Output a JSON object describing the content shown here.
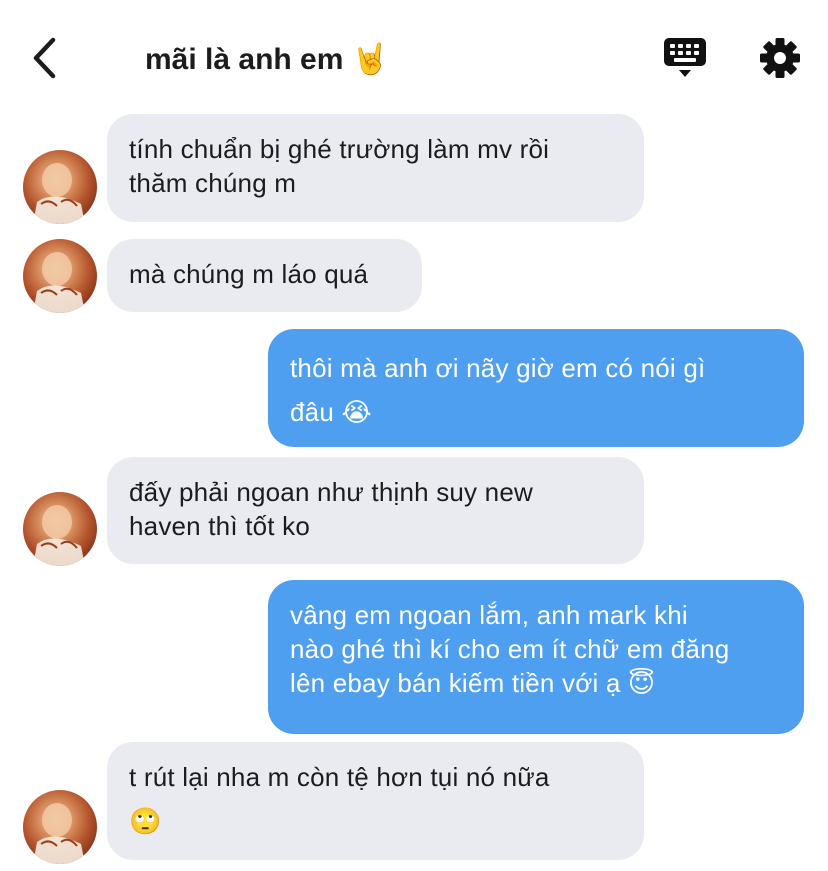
{
  "header": {
    "title": "mãi là anh em 🤘",
    "back_icon": "chevron-left-icon",
    "keyboard_icon": "keyboard-icon",
    "settings_icon": "gear-icon"
  },
  "colors": {
    "incoming_bubble": "#e9ebf0",
    "outgoing_bubble": "#4f9ff0"
  },
  "messages": [
    {
      "direction": "incoming",
      "lines": [
        "tính chuẩn bị ghé trường làm mv rồi",
        "thăm chúng m"
      ]
    },
    {
      "direction": "incoming",
      "lines": [
        "mà chúng m láo quá"
      ]
    },
    {
      "direction": "outgoing",
      "lines": [
        "thôi mà anh ơi nãy giờ em có nói gì",
        "đâu 😭"
      ]
    },
    {
      "direction": "incoming",
      "lines": [
        "đấy phải ngoan như thịnh suy new",
        "haven thì tốt ko"
      ]
    },
    {
      "direction": "outgoing",
      "lines": [
        "vâng em ngoan lắm, anh mark khi",
        "nào ghé thì kí cho em ít chữ em đăng",
        "lên ebay bán kiếm tiền với ạ 😇"
      ]
    },
    {
      "direction": "incoming",
      "lines": [
        "t rút lại nha m còn tệ hơn tụi nó nữa",
        "🙄"
      ]
    }
  ]
}
